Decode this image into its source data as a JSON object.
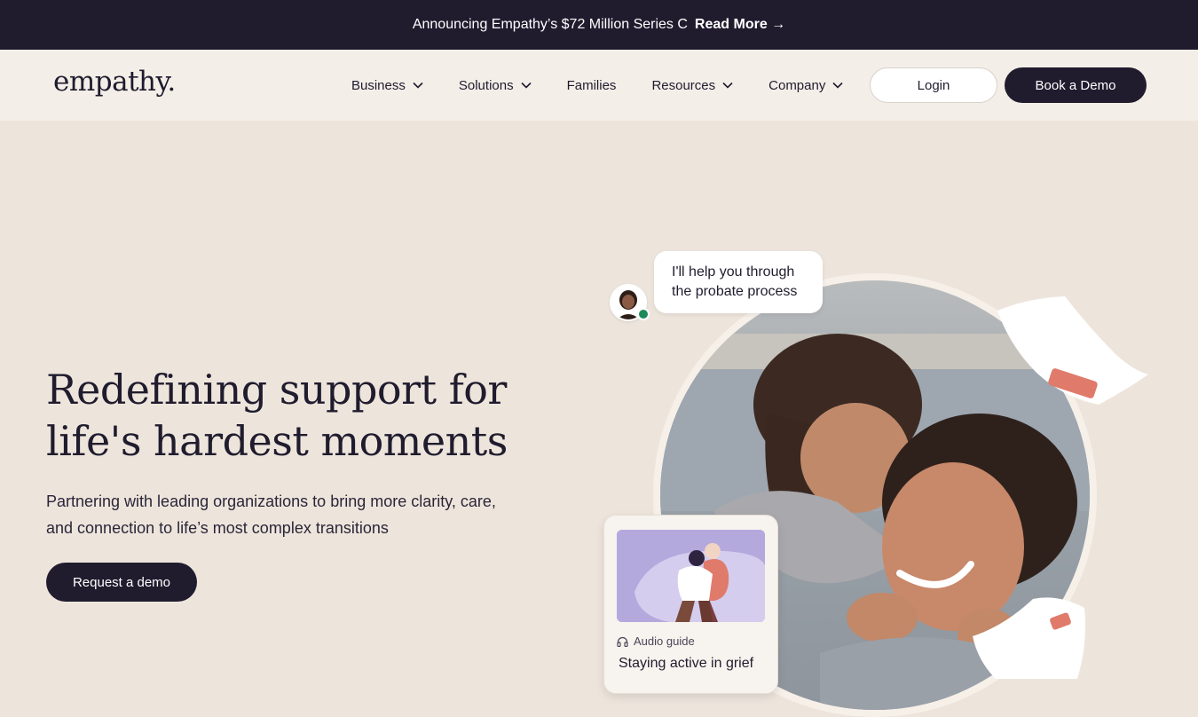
{
  "announcement": {
    "text": "Announcing Empathy’s $72 Million Series C",
    "link_label": "Read More →"
  },
  "nav": {
    "logo": "empathy.",
    "items": [
      {
        "label": "Business",
        "dropdown": true
      },
      {
        "label": "Solutions",
        "dropdown": true
      },
      {
        "label": "Families",
        "dropdown": false
      },
      {
        "label": "Resources",
        "dropdown": true
      },
      {
        "label": "Company",
        "dropdown": true
      }
    ],
    "login_label": "Login",
    "demo_label": "Book a Demo"
  },
  "hero": {
    "title_line1": "Redefining support for",
    "title_line2": "life's hardest moments",
    "subtitle_line1": "Partnering with leading organizations to bring more clarity, care,",
    "subtitle_line2": "and connection to life’s most complex transitions",
    "cta_label": "Request a demo"
  },
  "chat_bubble": {
    "line1": "I'll help you through",
    "line2": "the probate process"
  },
  "card": {
    "type_label": "Audio guide",
    "type_icon": "headphones-icon",
    "title": "Staying active in grief"
  },
  "colors": {
    "dark": "#201c2e",
    "background": "#ede5dc",
    "nav_bg": "#f4eee8",
    "online": "#1d8a5a",
    "accent_salmon": "#e07a6a",
    "card_lavender": "#b4a9dd"
  }
}
